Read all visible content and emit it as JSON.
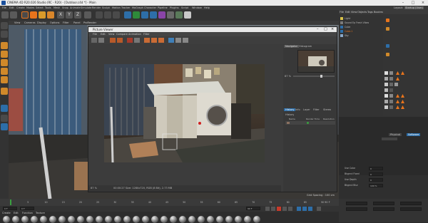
{
  "window": {
    "title": "CINEMA 4D R20.026 Studio (RC - R20) - [Outdoor.c4d *] - Main"
  },
  "menu": [
    "File",
    "Edit",
    "Create",
    "Modes",
    "Select",
    "Tools",
    "Mesh",
    "Snap",
    "Animate",
    "Simulate",
    "Render",
    "Sculpt",
    "Motion Tracker",
    "MoGraph",
    "Character",
    "Pipeline",
    "Plugins",
    "Script",
    "Window",
    "Help"
  ],
  "layout_label": "Layout:",
  "layout_value": "Startup (User)",
  "viewport": {
    "menu": [
      "View",
      "Cameras",
      "Display",
      "Options",
      "Filter",
      "Panel",
      "ProRender"
    ],
    "grid_spacing": "Grid Spacing : 100 cm"
  },
  "picture_viewer": {
    "title": "Picture Viewer",
    "menu": [
      "File",
      "Edit",
      "View",
      "Compare",
      "Animation",
      "Filter"
    ],
    "tabs": [
      "Navigator",
      "Histogram"
    ],
    "zoom": "87 %",
    "lower_tabs": [
      "History",
      "Info",
      "Layer",
      "Filter",
      "Stereo"
    ],
    "history_label": "History",
    "history_cols": [
      "Name",
      "Render Time",
      "Resolution"
    ],
    "status_zoom": "87 %",
    "status_text": "00:00:27    Size: 1280x720, RGB (8 Bit), 2.73 MB"
  },
  "object_manager": {
    "menu": [
      "File",
      "Edit",
      "View",
      "Objects",
      "Tags",
      "Bookmarks"
    ],
    "items": [
      "Light",
      "Sound Ep Fresh Vibes",
      "Cube",
      "Cube.1",
      "Sky"
    ]
  },
  "attribute_manager": {
    "tabs": [
      "Physical",
      "Software"
    ],
    "options": [
      "Use Color",
      "Bkgrnd Fixed",
      "Use Depth",
      "Bkgrnd Blur"
    ],
    "values": [
      "0",
      "0",
      "0",
      "100 %"
    ]
  },
  "timeline": {
    "ticks": [
      "0",
      "5",
      "10",
      "15",
      "20",
      "25",
      "30",
      "35",
      "40",
      "45",
      "50",
      "55",
      "60",
      "65",
      "70",
      "75",
      "80",
      "85",
      "90"
    ],
    "end_frame": "90 F",
    "start": "0 F",
    "current": "0 F",
    "max": "90 F"
  },
  "materials_bar": {
    "menu": [
      "Create",
      "Edit",
      "Function",
      "Texture"
    ]
  },
  "colors": {
    "accent": "#e8741c",
    "selected_blue": "#2d6ea8",
    "bg": "#2b2b2b"
  }
}
